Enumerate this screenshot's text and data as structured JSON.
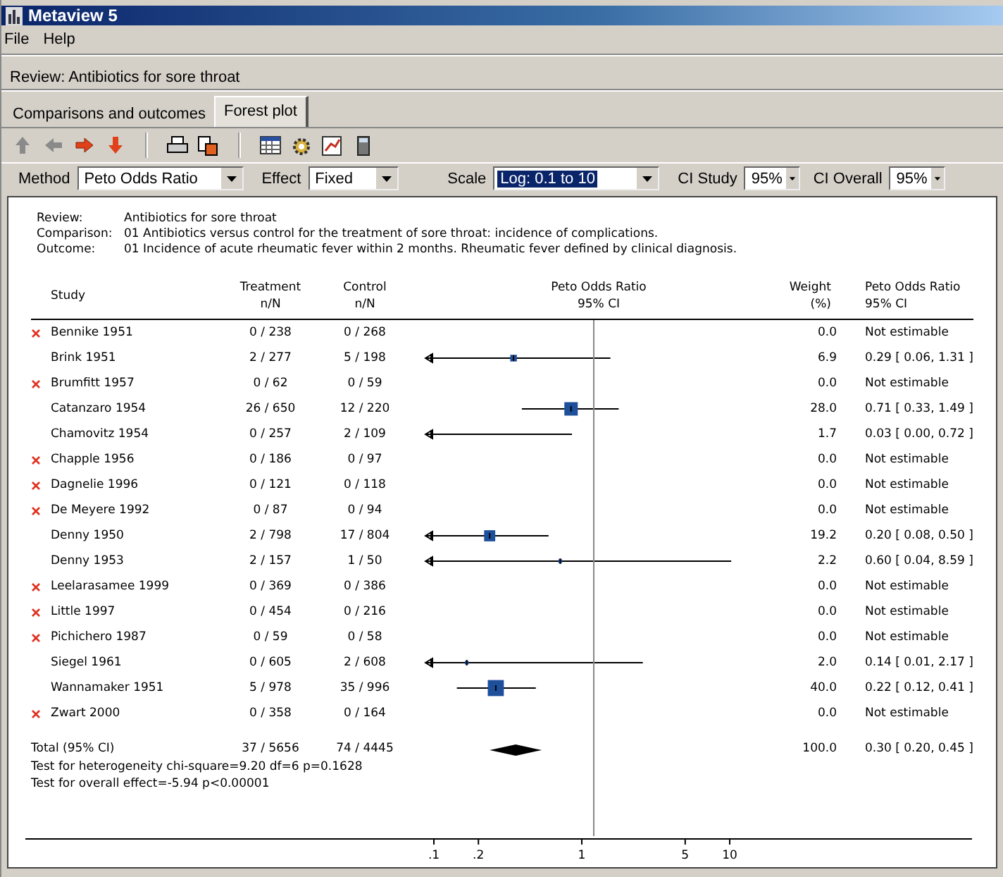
{
  "window": {
    "title": "Metaview 5"
  },
  "menu": [
    "File",
    "Help"
  ],
  "review_banner": "Review: Antibiotics for sore throat",
  "tabs": [
    {
      "label": "Comparisons and outcomes",
      "selected": false
    },
    {
      "label": "Forest plot",
      "selected": true
    }
  ],
  "toolbar": [
    {
      "kind": "up",
      "disabled": true
    },
    {
      "kind": "left",
      "disabled": true
    },
    {
      "kind": "right",
      "disabled": false
    },
    {
      "kind": "down",
      "disabled": false
    },
    {
      "kind": "sep"
    },
    {
      "kind": "print"
    },
    {
      "kind": "export"
    },
    {
      "kind": "sep"
    },
    {
      "kind": "table"
    },
    {
      "kind": "gear"
    },
    {
      "kind": "chart"
    },
    {
      "kind": "calc"
    }
  ],
  "options": [
    {
      "label": "Method",
      "value": "Peto Odds Ratio",
      "focused": false
    },
    {
      "label": "Effect",
      "value": "Fixed",
      "focused": false
    },
    {
      "label": "Scale",
      "value": "Log:  0.1 to 10",
      "focused": true
    },
    {
      "label": "CI Study",
      "value": "95%",
      "focused": false
    },
    {
      "label": "CI Overall",
      "value": "95%",
      "focused": false
    }
  ],
  "info": [
    {
      "label": "Review:",
      "value": "Antibiotics for sore throat"
    },
    {
      "label": "Comparison:",
      "value": "01 Antibiotics versus control for the treatment of sore throat: incidence of complications."
    },
    {
      "label": "Outcome:",
      "value": "01 Incidence of acute rheumatic fever within 2 months. Rheumatic fever defined by clinical diagnosis."
    }
  ],
  "columns": [
    {
      "title": "Study"
    },
    {
      "title": "Treatment",
      "subtitle": "n/N"
    },
    {
      "title": "Control",
      "subtitle": "n/N"
    },
    {
      "title": "Peto Odds Ratio",
      "subtitle": "95% CI"
    },
    {
      "title": "Weight",
      "subtitle": "(%)"
    },
    {
      "title": "Peto Odds Ratio",
      "subtitle": "95% CI"
    }
  ],
  "studies": [
    {
      "study": "Bennike 1951",
      "excluded": true,
      "treatment": "0 / 238",
      "control": "0 / 268",
      "weight": "0.0",
      "ci": "Not estimable"
    },
    {
      "study": "Brink 1951",
      "excluded": false,
      "treatment": "2 / 277",
      "control": "5 / 198",
      "weight": "6.9",
      "ci": "0.29 [ 0.06, 1.31 ]"
    },
    {
      "study": "Brumfitt 1957",
      "excluded": true,
      "treatment": "0 / 62",
      "control": "0 / 59",
      "weight": "0.0",
      "ci": "Not estimable"
    },
    {
      "study": "Catanzaro 1954",
      "excluded": false,
      "treatment": "26 / 650",
      "control": "12 / 220",
      "weight": "28.0",
      "ci": "0.71 [ 0.33, 1.49 ]"
    },
    {
      "study": "Chamovitz 1954",
      "excluded": false,
      "treatment": "0 / 257",
      "control": "2 / 109",
      "weight": "1.7",
      "ci": "0.03 [ 0.00, 0.72 ]"
    },
    {
      "study": "Chapple 1956",
      "excluded": true,
      "treatment": "0 / 186",
      "control": "0 / 97",
      "weight": "0.0",
      "ci": "Not estimable"
    },
    {
      "study": "Dagnelie 1996",
      "excluded": true,
      "treatment": "0 / 121",
      "control": "0 / 118",
      "weight": "0.0",
      "ci": "Not estimable"
    },
    {
      "study": "De Meyere 1992",
      "excluded": true,
      "treatment": "0 / 87",
      "control": "0 / 94",
      "weight": "0.0",
      "ci": "Not estimable"
    },
    {
      "study": "Denny 1950",
      "excluded": false,
      "treatment": "2 / 798",
      "control": "17 / 804",
      "weight": "19.2",
      "ci": "0.20 [ 0.08, 0.50 ]"
    },
    {
      "study": "Denny 1953",
      "excluded": false,
      "treatment": "2 / 157",
      "control": "1 / 50",
      "weight": "2.2",
      "ci": "0.60 [ 0.04, 8.59 ]"
    },
    {
      "study": "Leelarasamee 1999",
      "excluded": true,
      "treatment": "0 / 369",
      "control": "0 / 386",
      "weight": "0.0",
      "ci": "Not estimable"
    },
    {
      "study": "Little 1997",
      "excluded": true,
      "treatment": "0 / 454",
      "control": "0 / 216",
      "weight": "0.0",
      "ci": "Not estimable"
    },
    {
      "study": "Pichichero 1987",
      "excluded": true,
      "treatment": "0 / 59",
      "control": "0 / 58",
      "weight": "0.0",
      "ci": "Not estimable"
    },
    {
      "study": "Siegel 1961",
      "excluded": false,
      "treatment": "0 / 605",
      "control": "2 / 608",
      "weight": "2.0",
      "ci": "0.14 [ 0.01, 2.17 ]"
    },
    {
      "study": "Wannamaker 1951",
      "excluded": false,
      "treatment": "5 / 978",
      "control": "35 / 996",
      "weight": "40.0",
      "ci": "0.22 [ 0.12, 0.41 ]"
    },
    {
      "study": "Zwart 2000",
      "excluded": true,
      "treatment": "0 / 358",
      "control": "0 / 164",
      "weight": "0.0",
      "ci": "Not estimable"
    }
  ],
  "total": {
    "label": "Total (95% CI)",
    "treatment": "37 / 5656",
    "control": "74 / 4445",
    "weight": "100.0",
    "ci": "0.30 [ 0.20, 0.45 ]"
  },
  "tests": [
    "Test for heterogeneity chi-square=9.20 df=6 p=0.1628",
    "Test for overall effect=-5.94 p<0.00001"
  ],
  "axis_ticks": [
    ".1",
    ".2",
    "1",
    "5",
    "10"
  ]
}
